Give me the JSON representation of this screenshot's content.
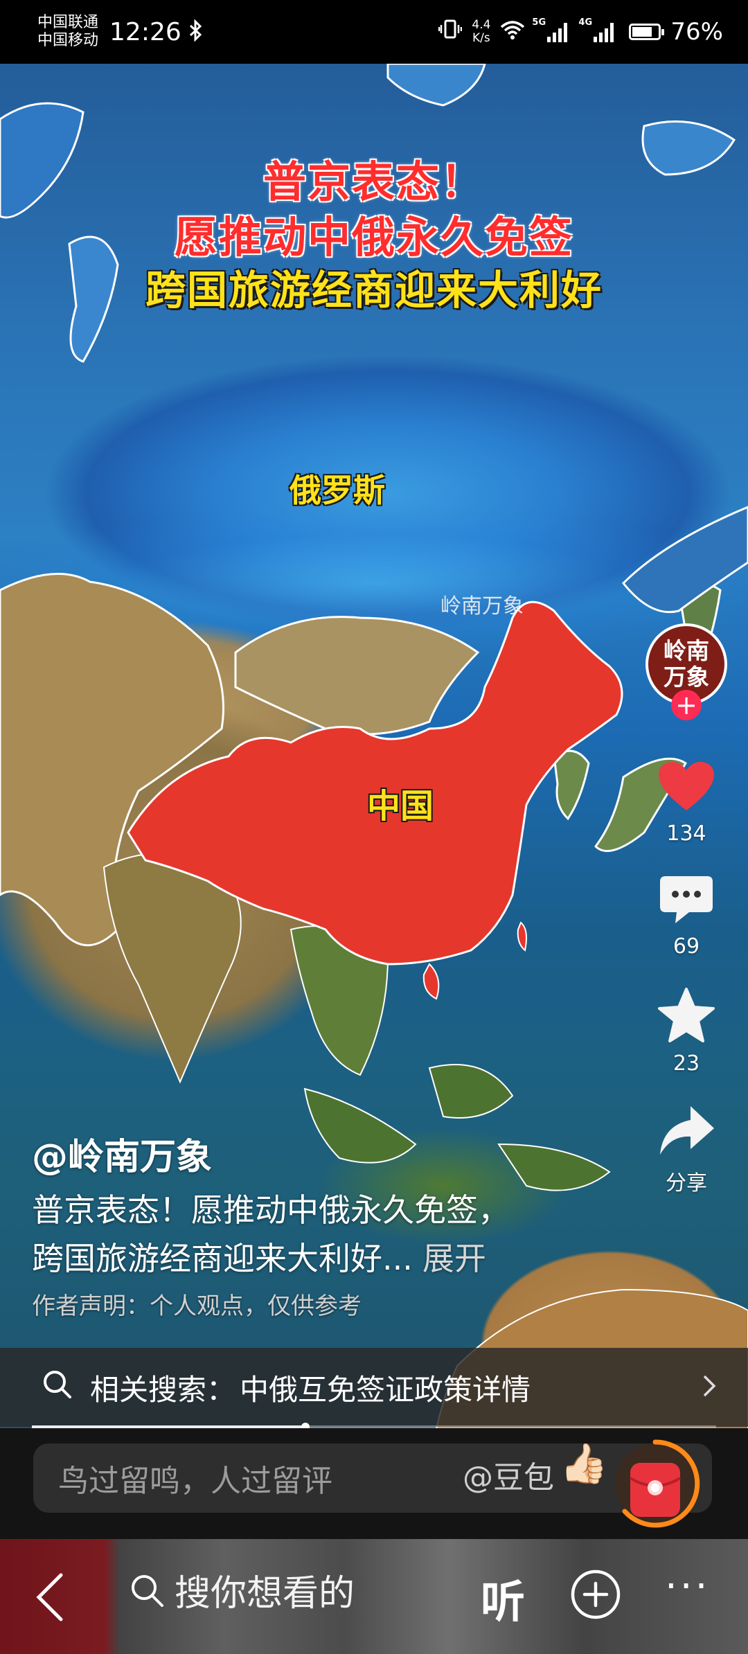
{
  "status_bar": {
    "carrier_1": "中国联通",
    "carrier_2": "中国移动",
    "time": "12:26",
    "net_speed_value": "4.4",
    "net_speed_unit": "K/s",
    "sim1_type": "5G",
    "sim2_type": "4G",
    "battery": "76%",
    "battery_level": 0.76
  },
  "video": {
    "caption_line_1": "普京表态！",
    "caption_line_2": "愿推动中俄永久免签",
    "caption_line_3": "跨国旅游经商迎来大利好",
    "map_label_russia": "俄罗斯",
    "map_label_china": "中国",
    "watermark": "岭南万象"
  },
  "actions": {
    "avatar_text": "岭南万象",
    "follow_symbol": "+",
    "likes": "134",
    "comments": "69",
    "favorites": "23",
    "share_label": "分享"
  },
  "post": {
    "author": "@岭南万象",
    "description_line_1": "普京表态！愿推动中俄永久免签，",
    "description_line_2": "跨国旅游经商迎来大利好...",
    "expand_label": "展开",
    "disclaimer": "作者声明：个人观点，仅供参考"
  },
  "related_search": {
    "label": "相关搜索：",
    "query": "中俄互免签证政策详情"
  },
  "progress": {
    "played_fraction": 0.4
  },
  "comment_bar": {
    "placeholder": "鸟过留鸣，人过留评",
    "mention": "@豆包",
    "emoji": "👍🏻"
  },
  "bottom_nav": {
    "search_placeholder": "搜你想看的",
    "listen_label": "听",
    "more_label": "···"
  },
  "colors": {
    "accent_red": "#fe2c55",
    "caption_red": "#ff2d2d",
    "caption_yellow": "#ffe21a",
    "like_red": "#ee3a43"
  }
}
